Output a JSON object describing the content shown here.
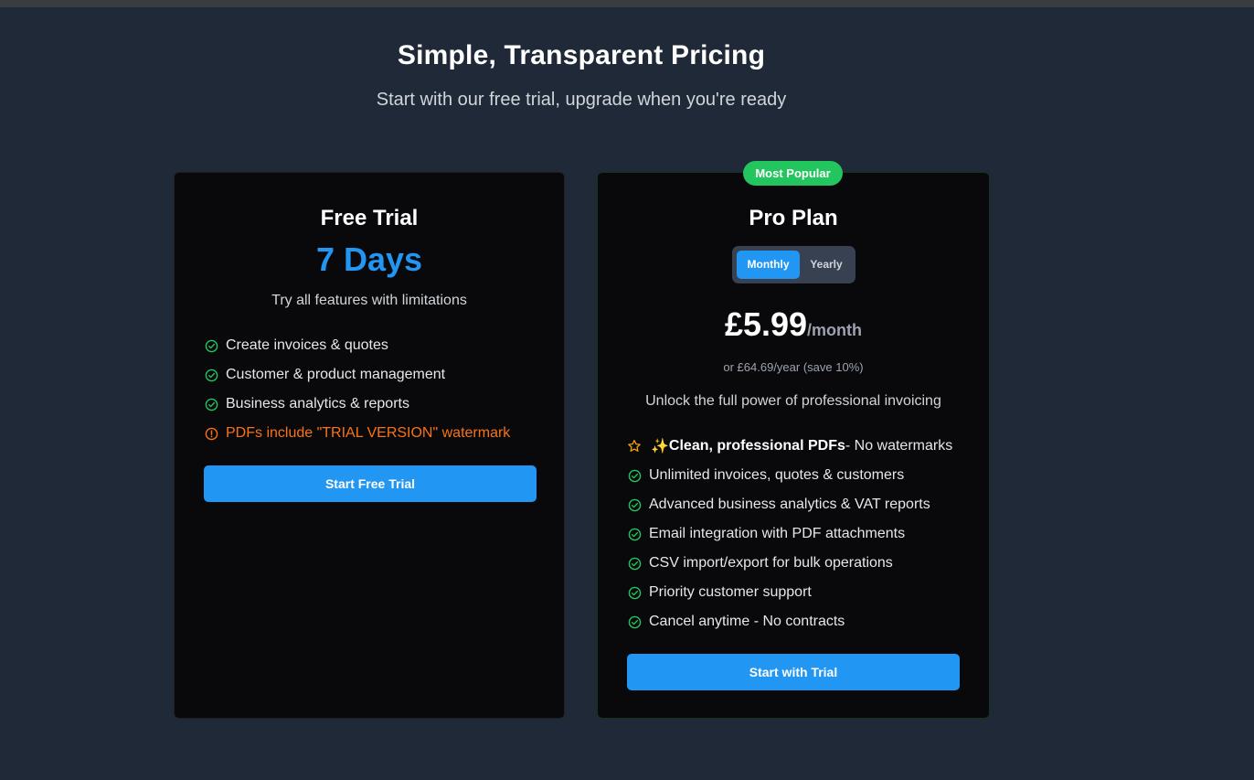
{
  "header": {
    "title": "Simple, Transparent Pricing",
    "subtitle": "Start with our free trial, upgrade when you're ready"
  },
  "free_plan": {
    "title": "Free Trial",
    "duration": "7 Days",
    "description": "Try all features with limitations",
    "features": [
      "Create invoices & quotes",
      "Customer & product management",
      "Business analytics & reports"
    ],
    "warning": "PDFs include \"TRIAL VERSION\" watermark",
    "button_label": "Start Free Trial"
  },
  "pro_plan": {
    "badge": "Most Popular",
    "title": "Pro Plan",
    "billing_options": {
      "monthly": "Monthly",
      "yearly": "Yearly",
      "selected": "Monthly"
    },
    "price": "£5.99",
    "period": "/month",
    "alt_price": "or £64.69/year (save 10%)",
    "description": "Unlock the full power of professional invoicing",
    "highlight": {
      "emoji": "✨",
      "bold": "Clean, professional PDFs",
      "rest": "- No watermarks"
    },
    "features": [
      "Unlimited invoices, quotes & customers",
      "Advanced business analytics & VAT reports",
      "Email integration with PDF attachments",
      "CSV import/export for bulk operations",
      "Priority customer support",
      "Cancel anytime - No contracts"
    ],
    "button_label": "Start with Trial"
  },
  "colors": {
    "background": "#1f2937",
    "card": "#09090b",
    "accent_blue": "#2196f3",
    "success_green": "#22c55e",
    "warning_orange": "#f97316",
    "star_yellow": "#f59e0b"
  },
  "icons": {
    "check": "check-circle-icon",
    "warning": "alert-circle-icon",
    "star": "star-icon"
  }
}
